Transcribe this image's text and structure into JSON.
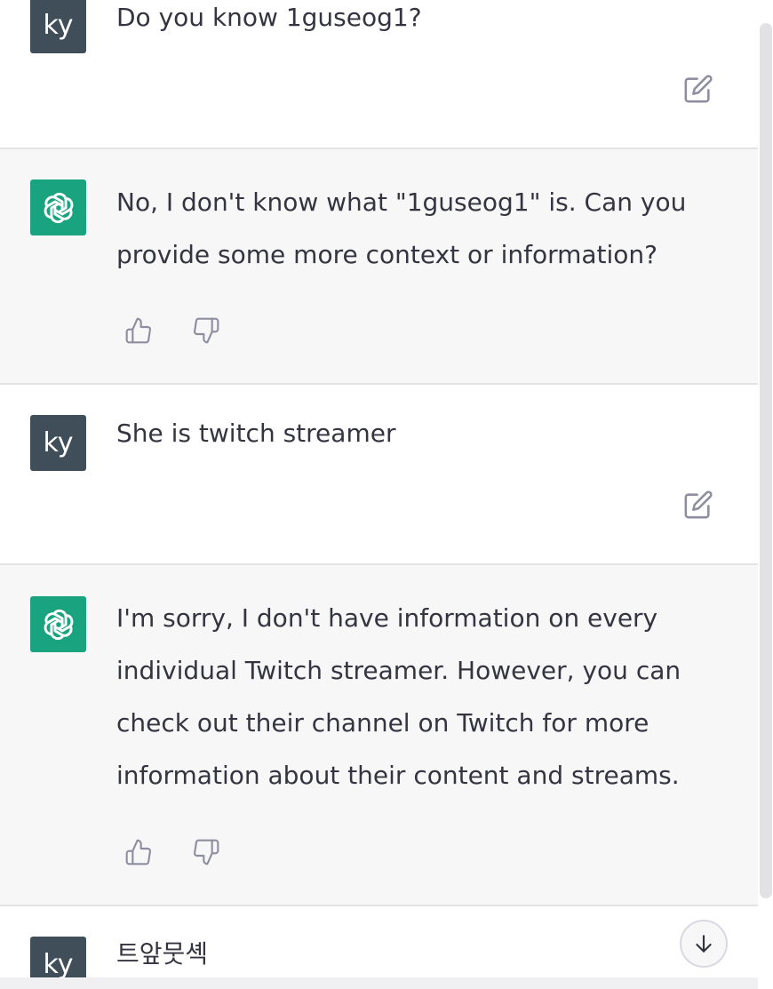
{
  "conversation": {
    "messages": [
      {
        "role": "user",
        "avatar_text": "ky",
        "text": "Do you know 1guseog1?"
      },
      {
        "role": "assistant",
        "avatar_icon": "openai-logo-icon",
        "text": "No, I don't know what \"1guseog1\" is. Can you\nprovide some more context or information?"
      },
      {
        "role": "user",
        "avatar_text": "ky",
        "text": "She is twitch streamer"
      },
      {
        "role": "assistant",
        "avatar_icon": "openai-logo-icon",
        "text": "I'm sorry, I don't have information on every\nindividual Twitch streamer. However, you can\ncheck out their channel on Twitch for more\ninformation about their content and streams."
      },
      {
        "role": "user",
        "avatar_text": "ky",
        "text": "트앞뭇셱"
      }
    ],
    "icons": {
      "edit": "edit-icon",
      "thumbs_up": "thumbs-up-icon",
      "thumbs_down": "thumbs-down-icon",
      "scroll_down": "arrow-down-icon"
    }
  },
  "colors": {
    "user_avatar_bg": "#3f4e58",
    "gpt_avatar_bg": "#19a37f",
    "assistant_row_bg": "#f7f7f8"
  }
}
